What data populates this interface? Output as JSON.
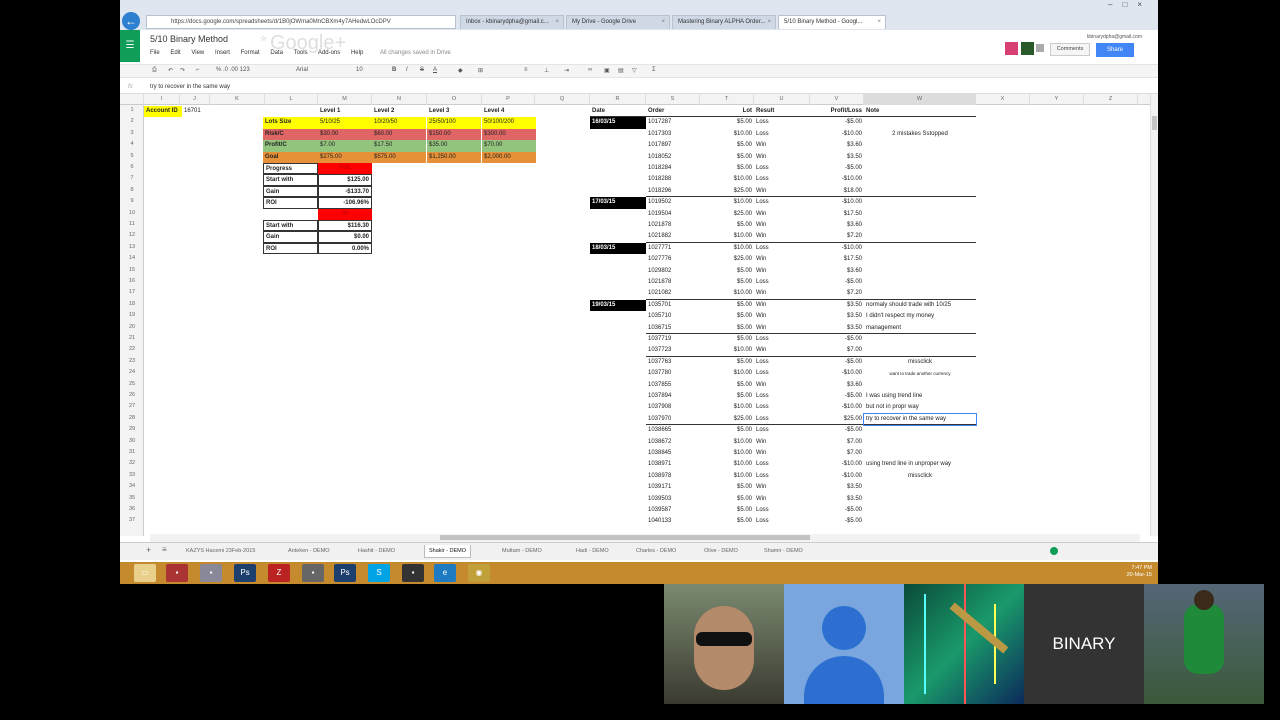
{
  "browser": {
    "url": "https://docs.google.com/spreadsheets/d/1B0jOWma0MnCBXm4y7AHedwLOcDPV",
    "tabs": [
      {
        "label": "Inbox - kbinarydpha@gmail.c..."
      },
      {
        "label": "My Drive - Google Drive"
      },
      {
        "label": "Mastering Binary ALPHA Order..."
      },
      {
        "label": "5/10 Binary Method - Googl..."
      }
    ],
    "watermark": "Google+"
  },
  "doc": {
    "title": "5/10 Binary Method",
    "menu": [
      "File",
      "Edit",
      "View",
      "Insert",
      "Format",
      "Data",
      "Tools",
      "Add-ons",
      "Help"
    ],
    "saved_status": "All changes saved in Drive",
    "user_email": "kbinarydpha@gmail.com",
    "comments_label": "Comments",
    "share_label": "Share"
  },
  "toolbar": {
    "number_formats": "% .0 .00 123",
    "font": "Arial",
    "font_size": "10",
    "bold": "B",
    "italic": "I",
    "strike": "S",
    "textcolor": "A"
  },
  "formula": {
    "fx": "fx",
    "value": "try to recover in the same way"
  },
  "columns": [
    "",
    "I",
    "J",
    "K",
    "L",
    "M",
    "N",
    "O",
    "P",
    "Q",
    "R",
    "S",
    "T",
    "U",
    "V",
    "W",
    "X",
    "Y",
    "Z"
  ],
  "account": {
    "label": "Account ID",
    "value": "16701"
  },
  "levels": {
    "headers": [
      "Level 1",
      "Level 2",
      "Level 3",
      "Level 4"
    ],
    "rows": [
      {
        "label": "Lots Size",
        "values": [
          "5/10/25",
          "10/20/50",
          "25/50/100",
          "50/100/200"
        ],
        "color": "#ffff00"
      },
      {
        "label": "Risk/C",
        "values": [
          "$30.00",
          "$60.00",
          "$150.00",
          "$300.00"
        ],
        "color": "#e06666"
      },
      {
        "label": "Profit/C",
        "values": [
          "$7.00",
          "$17.50",
          "$35.00",
          "$70.00"
        ],
        "color": "#93c47d"
      },
      {
        "label": "Goal",
        "values": [
          "$275.00",
          "$575.00",
          "$1,250.00",
          "$2,000.00"
        ],
        "color": "#e69138"
      }
    ]
  },
  "progress": {
    "label": "Progress",
    "value": "FAIL",
    "color": "#ff0000"
  },
  "stats1": [
    {
      "label": "Start with",
      "value": "$125.00"
    },
    {
      "label": "Gain",
      "value": "-$133.70"
    },
    {
      "label": "ROI",
      "value": "-106.96%"
    }
  ],
  "midbadge": {
    "value": "W"
  },
  "stats2": [
    {
      "label": "Start with",
      "value": "$116.30"
    },
    {
      "label": "Gain",
      "value": "$0.00"
    },
    {
      "label": "ROI",
      "value": "0.00%"
    }
  ],
  "trades_headers": {
    "date": "Date",
    "order": "Order",
    "lot": "Lot",
    "result": "Result",
    "pl": "Profit/Loss",
    "note": "Note"
  },
  "dates": [
    "16/03/15",
    "17/03/15",
    "18/03/15",
    "19/03/15"
  ],
  "trades": [
    {
      "order": "1017287",
      "lot": "$5.00",
      "result": "Loss",
      "pl": "-$5.00",
      "note": ""
    },
    {
      "order": "1017303",
      "lot": "$10.00",
      "result": "Loss",
      "pl": "-$10.00",
      "note": "2 mistakes Sstopped"
    },
    {
      "order": "1017897",
      "lot": "$5.00",
      "result": "Win",
      "pl": "$3.60",
      "note": ""
    },
    {
      "order": "1018052",
      "lot": "$5.00",
      "result": "Win",
      "pl": "$3.50",
      "note": ""
    },
    {
      "order": "1018284",
      "lot": "$5.00",
      "result": "Loss",
      "pl": "-$5.00",
      "note": ""
    },
    {
      "order": "1018288",
      "lot": "$10.00",
      "result": "Loss",
      "pl": "-$10.00",
      "note": ""
    },
    {
      "order": "1018296",
      "lot": "$25.00",
      "result": "Win",
      "pl": "$18.00",
      "note": ""
    },
    {
      "order": "1019502",
      "lot": "$10.00",
      "result": "Loss",
      "pl": "-$10.00",
      "note": ""
    },
    {
      "order": "1019504",
      "lot": "$25.00",
      "result": "Win",
      "pl": "$17.50",
      "note": ""
    },
    {
      "order": "1021878",
      "lot": "$5.00",
      "result": "Win",
      "pl": "$3.60",
      "note": ""
    },
    {
      "order": "1021882",
      "lot": "$10.00",
      "result": "Win",
      "pl": "$7.20",
      "note": ""
    },
    {
      "order": "1027771",
      "lot": "$10.00",
      "result": "Loss",
      "pl": "-$10.00",
      "note": ""
    },
    {
      "order": "1027776",
      "lot": "$25.00",
      "result": "Win",
      "pl": "$17.50",
      "note": ""
    },
    {
      "order": "1029802",
      "lot": "$5.00",
      "result": "Win",
      "pl": "$3.60",
      "note": ""
    },
    {
      "order": "1021878",
      "lot": "$5.00",
      "result": "Loss",
      "pl": "-$5.00",
      "note": ""
    },
    {
      "order": "1021082",
      "lot": "$10.00",
      "result": "Win",
      "pl": "$7.20",
      "note": ""
    },
    {
      "order": "1035701",
      "lot": "$5.00",
      "result": "Win",
      "pl": "$3.50",
      "note": "normaly should trade with 10/25"
    },
    {
      "order": "1035710",
      "lot": "$5.00",
      "result": "Win",
      "pl": "$3.50",
      "note": "I didn't respect my money"
    },
    {
      "order": "1036715",
      "lot": "$5.00",
      "result": "Win",
      "pl": "$3.50",
      "note": "management"
    },
    {
      "order": "1037719",
      "lot": "$5.00",
      "result": "Loss",
      "pl": "-$5.00",
      "note": ""
    },
    {
      "order": "1037723",
      "lot": "$10.00",
      "result": "Win",
      "pl": "$7.00",
      "note": ""
    },
    {
      "order": "1037763",
      "lot": "$5.00",
      "result": "Loss",
      "pl": "-$5.00",
      "note": "missclick"
    },
    {
      "order": "1037780",
      "lot": "$10.00",
      "result": "Loss",
      "pl": "-$10.00",
      "note": "want to trade another currency"
    },
    {
      "order": "1037855",
      "lot": "$5.00",
      "result": "Win",
      "pl": "$3.60",
      "note": ""
    },
    {
      "order": "1037894",
      "lot": "$5.00",
      "result": "Loss",
      "pl": "-$5.00",
      "note": "I was using trend line"
    },
    {
      "order": "1037908",
      "lot": "$10.00",
      "result": "Loss",
      "pl": "-$10.00",
      "note": "but not in propr way"
    },
    {
      "order": "1037970",
      "lot": "$25.00",
      "result": "Loss",
      "pl": "$25.00",
      "note": "try to recover in the same way"
    },
    {
      "order": "1038665",
      "lot": "$5.00",
      "result": "Loss",
      "pl": "-$5.00",
      "note": ""
    },
    {
      "order": "1038672",
      "lot": "$10.00",
      "result": "Win",
      "pl": "$7.00",
      "note": ""
    },
    {
      "order": "1038845",
      "lot": "$10.00",
      "result": "Win",
      "pl": "$7.00",
      "note": ""
    },
    {
      "order": "1038971",
      "lot": "$10.00",
      "result": "Loss",
      "pl": "-$10.00",
      "note": "using trend line in unproper way"
    },
    {
      "order": "1038978",
      "lot": "$10.00",
      "result": "Loss",
      "pl": "-$10.00",
      "note": "missclick"
    },
    {
      "order": "1039171",
      "lot": "$5.00",
      "result": "Win",
      "pl": "$3.50",
      "note": ""
    },
    {
      "order": "1039503",
      "lot": "$5.00",
      "result": "Win",
      "pl": "$3.50",
      "note": ""
    },
    {
      "order": "1039587",
      "lot": "$5.00",
      "result": "Loss",
      "pl": "-$5.00",
      "note": ""
    },
    {
      "order": "1040133",
      "lot": "$5.00",
      "result": "Loss",
      "pl": "-$5.00",
      "note": ""
    }
  ],
  "sheet_tabs": [
    "KAZYS Hacemi 23Feb-2015",
    "Anteken - DEMO",
    "Hashit - DEMO",
    "Shakir - DEMO",
    "Muttam - DEMO",
    "Hadi - DEMO",
    "Charles - DEMO",
    "Olive - DEMO",
    "Shamir - DEMO"
  ],
  "taskbar": {
    "time": "7:47 PM",
    "date": "20-Mar-15"
  },
  "video": {
    "binary_label": "BINARY"
  }
}
